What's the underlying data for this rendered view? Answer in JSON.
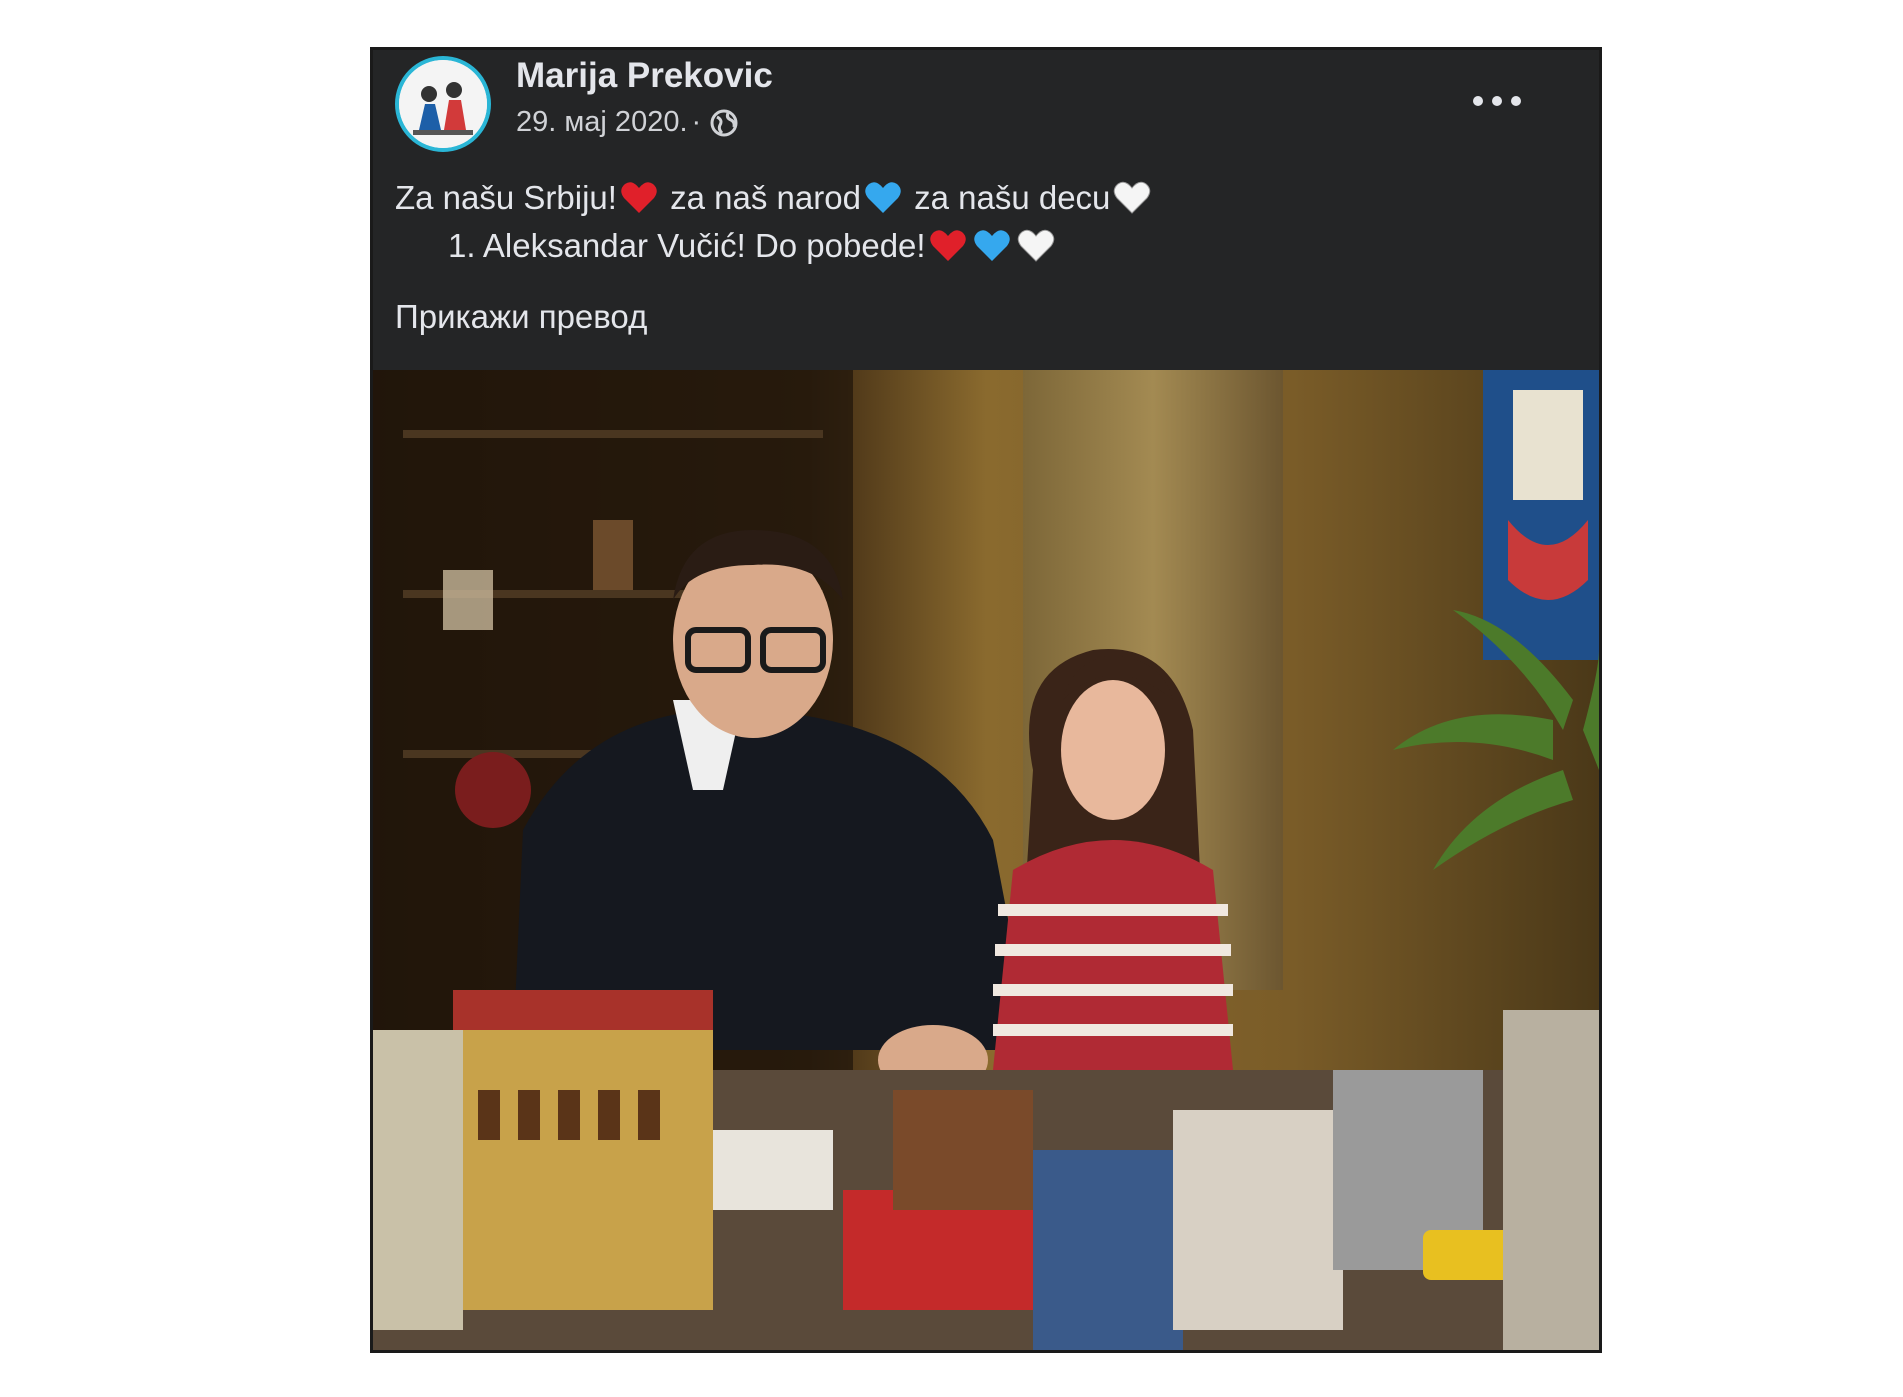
{
  "post": {
    "author": "Marija Prekovic",
    "date": "29. мај 2020.",
    "separator": "·",
    "privacy_icon": "globe-icon",
    "menu_icon": "more-options-icon",
    "text_line1_a": "Za našu Srbiju!",
    "text_line1_b": " za naš narod",
    "text_line1_c": " za našu decu",
    "text_line2": "1. Aleksandar Vučić! Do pobede!",
    "translate_label": "Прикажи превод",
    "hearts": {
      "red": "#e0202a",
      "blue": "#35a8ee",
      "white": "#f5f5f5"
    }
  },
  "colors": {
    "card_bg": "#242526",
    "text": "#e4e6eb",
    "avatar_ring": "#2ab6d6"
  }
}
